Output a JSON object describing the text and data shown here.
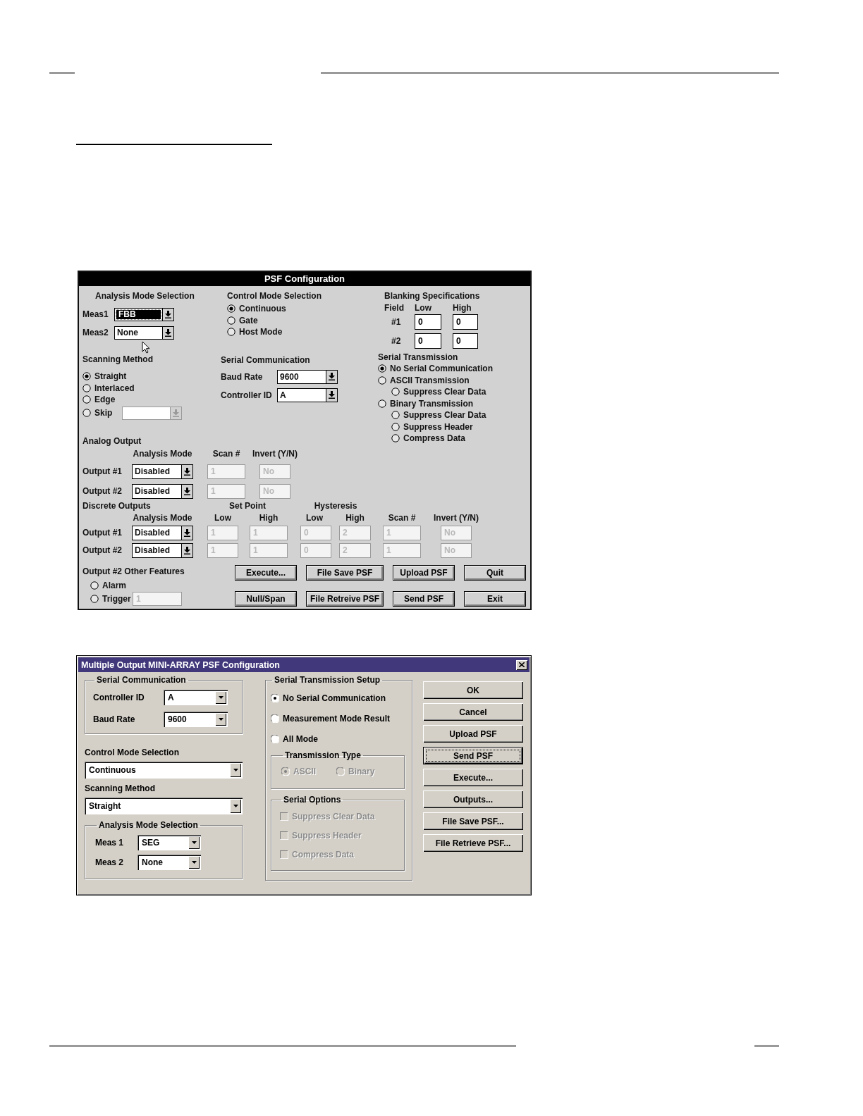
{
  "dialog_1": {
    "title": "PSF Configuration",
    "analysis_mode": {
      "heading": "Analysis Mode Selection",
      "fields": [
        {
          "label": "Meas1",
          "value": "FBB",
          "focused": true
        },
        {
          "label": "Meas2",
          "value": "None",
          "focused": false
        }
      ]
    },
    "control_mode": {
      "heading": "Control Mode Selection",
      "options": [
        {
          "label": "Continuous",
          "selected": true
        },
        {
          "label": "Gate",
          "selected": false
        },
        {
          "label": "Host Mode",
          "selected": false
        }
      ]
    },
    "blanking": {
      "heading": "Blanking Specifications",
      "columns": [
        "Field",
        "Low",
        "High"
      ],
      "rows": [
        {
          "field": "#1",
          "low": "0",
          "high": "0"
        },
        {
          "field": "#2",
          "low": "0",
          "high": "0"
        }
      ]
    },
    "scanning_method": {
      "heading": "Scanning Method",
      "options": [
        {
          "label": "Straight",
          "selected": true,
          "kind": "plain"
        },
        {
          "label": "Interlaced",
          "selected": false,
          "kind": "plain"
        },
        {
          "label": "Edge",
          "selected": false,
          "kind": "plain"
        },
        {
          "label": "Skip",
          "selected": false,
          "kind": "with_dropdown",
          "dropdown_disabled": true
        }
      ]
    },
    "serial_communication": {
      "heading": "Serial Communication",
      "fields": [
        {
          "label": "Baud Rate",
          "value": "9600"
        },
        {
          "label": "Controller ID",
          "value": "A"
        }
      ]
    },
    "serial_transmission": {
      "heading": "Serial Transmission",
      "options": [
        {
          "label": "No Serial Communication",
          "selected": true
        },
        {
          "label": "ASCII Transmission",
          "selected": false,
          "children": [
            {
              "label": "Suppress Clear Data",
              "selected": false
            }
          ]
        },
        {
          "label": "Binary Transmission",
          "selected": false,
          "children": [
            {
              "label": "Suppress Clear Data",
              "selected": false
            },
            {
              "label": "Suppress Header",
              "selected": false
            },
            {
              "label": "Compress Data",
              "selected": false
            }
          ]
        }
      ]
    },
    "analog_output": {
      "heading": "Analog Output",
      "columns": [
        "Analysis Mode",
        "Scan #",
        "Invert (Y/N)"
      ],
      "rows": [
        {
          "label": "Output #1",
          "mode": "Disabled",
          "scan": "1",
          "invert": "No",
          "disabled": true
        },
        {
          "label": "Output #2",
          "mode": "Disabled",
          "scan": "1",
          "invert": "No",
          "disabled": true
        }
      ]
    },
    "discrete_outputs": {
      "heading": "Discrete Outputs",
      "groups": [
        "Set Point",
        "Hysteresis"
      ],
      "columns": [
        "Analysis Mode",
        "Low",
        "High",
        "Low",
        "High",
        "Scan #",
        "Invert (Y/N)"
      ],
      "rows": [
        {
          "label": "Output #1",
          "mode": "Disabled",
          "values": [
            "1",
            "1",
            "0",
            "2",
            "1",
            "No"
          ],
          "disabled": true
        },
        {
          "label": "Output #2",
          "mode": "Disabled",
          "values": [
            "1",
            "1",
            "0",
            "2",
            "1",
            "No"
          ],
          "disabled": true
        }
      ]
    },
    "other_features": {
      "heading": "Output #2 Other Features",
      "options": [
        {
          "label": "Alarm",
          "selected": false
        },
        {
          "label": "Trigger",
          "selected": false
        }
      ],
      "trigger_value": "1",
      "trigger_disabled": true
    },
    "buttons": [
      {
        "label": "Execute..."
      },
      {
        "label": "File Save PSF"
      },
      {
        "label": "Upload PSF"
      },
      {
        "label": "Quit"
      },
      {
        "label": "Null/Span"
      },
      {
        "label": "File Retreive PSF"
      },
      {
        "label": "Send PSF"
      },
      {
        "label": "Exit"
      }
    ]
  },
  "dialog_2": {
    "title": "Multiple Output MINI-ARRAY PSF Configuration",
    "serial_communication": {
      "heading": "Serial Communication",
      "fields": [
        {
          "label": "Controller ID",
          "value": "A"
        },
        {
          "label": "Baud Rate",
          "value": "9600"
        }
      ]
    },
    "control_mode": {
      "heading": "Control Mode Selection",
      "value": "Continuous"
    },
    "scanning_method": {
      "heading": "Scanning Method",
      "value": "Straight"
    },
    "analysis_mode": {
      "heading": "Analysis Mode Selection",
      "fields": [
        {
          "label": "Meas 1",
          "value": "SEG"
        },
        {
          "label": "Meas 2",
          "value": "None"
        }
      ]
    },
    "serial_transmission": {
      "heading": "Serial Transmission Setup",
      "options": [
        {
          "label": "No Serial Communication",
          "selected": true
        },
        {
          "label": "Measurement Mode Result",
          "selected": false
        },
        {
          "label": "All Mode",
          "selected": false
        }
      ],
      "transmission_type": {
        "heading": "Transmission Type",
        "disabled": true,
        "options": [
          {
            "label": "ASCII",
            "selected": true
          },
          {
            "label": "Binary",
            "selected": false
          }
        ]
      },
      "serial_options": {
        "heading": "Serial Options",
        "options": [
          {
            "label": "Suppress Clear Data",
            "checked": false,
            "disabled": true
          },
          {
            "label": "Suppress Header",
            "checked": false,
            "disabled": true
          },
          {
            "label": "Compress Data",
            "checked": false,
            "disabled": true
          }
        ]
      }
    },
    "buttons": [
      {
        "label": "OK",
        "focused": false
      },
      {
        "label": "Cancel",
        "focused": false
      },
      {
        "label": "Upload PSF",
        "focused": false
      },
      {
        "label": "Send PSF",
        "focused": true
      },
      {
        "label": "Execute...",
        "focused": false
      },
      {
        "label": "Outputs...",
        "focused": false
      },
      {
        "label": "File Save PSF...",
        "focused": false
      },
      {
        "label": "File Retrieve PSF...",
        "focused": false
      }
    ]
  }
}
